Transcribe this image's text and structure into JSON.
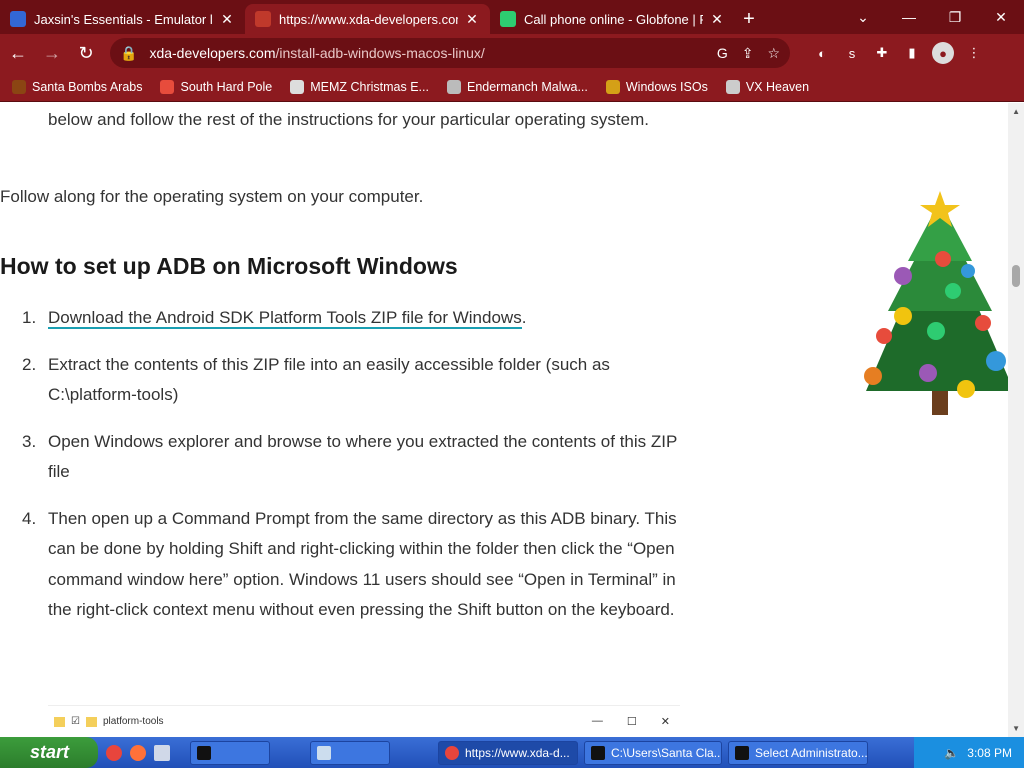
{
  "tabs": [
    {
      "title": "Jaxsin's Essentials - Emulator list",
      "close": "✕",
      "favicon_color": "#3367d6"
    },
    {
      "title": "https://www.xda-developers.com",
      "close": "✕",
      "favicon_color": "#c0392b"
    },
    {
      "title": "Call phone online - Globfone | F",
      "close": "✕",
      "favicon_color": "#2ecc71"
    }
  ],
  "window": {
    "newtab": "+",
    "dropdown": "⌄",
    "minimize": "—",
    "restore": "❐",
    "close": "✕"
  },
  "omnibox": {
    "host": "xda-developers.com",
    "path": "/install-adb-windows-macos-linux/"
  },
  "bookmarks": [
    {
      "label": "Santa Bombs Arabs",
      "icon_color": "#8b4513"
    },
    {
      "label": "South Hard Pole",
      "icon_color": "#e74c3c"
    },
    {
      "label": "MEMZ Christmas E...",
      "icon_color": "#dddddd"
    },
    {
      "label": "Endermanch Malwa...",
      "icon_color": "#bbbbbb"
    },
    {
      "label": "Windows ISOs",
      "icon_color": "#d4a017"
    },
    {
      "label": "VX Heaven",
      "icon_color": "#cccccc"
    }
  ],
  "article": {
    "intro": "below and follow the rest of the instructions for your particular operating system.",
    "follow": "Follow along for the operating system on your computer.",
    "heading": "How to set up ADB on Microsoft Windows",
    "steps": [
      {
        "num": "1.",
        "link": "Download the Android SDK Platform Tools ZIP file for Windows",
        "text": "."
      },
      {
        "num": "2.",
        "link": "",
        "text": "Extract the contents of this ZIP file into an easily accessible folder (such as C:\\platform-tools)"
      },
      {
        "num": "3.",
        "link": "",
        "text": "Open Windows explorer and browse to where you extracted the contents of this ZIP file"
      },
      {
        "num": "4.",
        "link": "",
        "text": "Then open up a Command Prompt from the same directory as this ADB binary. This can be done by holding Shift and right-clicking within the folder then click the “Open command window here” option. Windows 11 users should see “Open in Terminal” in the right-click context menu without even pressing the Shift button on the keyboard."
      }
    ],
    "explorer_title": "platform-tools"
  },
  "taskbar": {
    "start": "start",
    "tasks": [
      {
        "label": "https://www.xda-d...",
        "icon_color": "#e8453c"
      },
      {
        "label": "C:\\Users\\Santa Cla...",
        "icon_color": "#111111"
      },
      {
        "label": "Select Administrato...",
        "icon_color": "#111111"
      }
    ],
    "clock": "3:08 PM"
  }
}
